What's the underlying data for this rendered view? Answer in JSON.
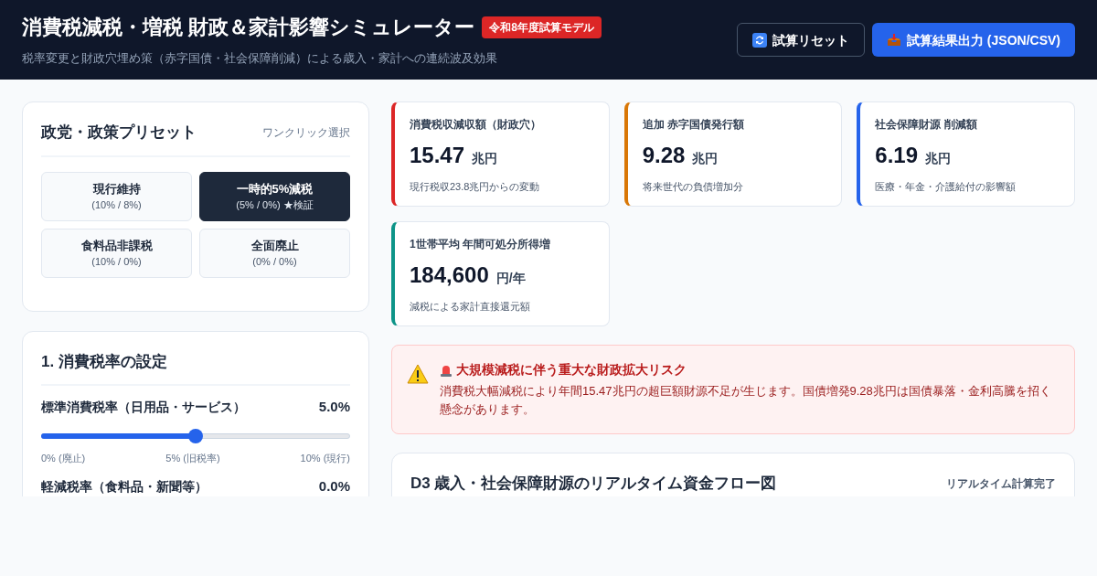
{
  "header": {
    "title": "消費税減税・増税 財政＆家計影響シミュレーター",
    "badge": "令和8年度試算モデル",
    "subtitle": "税率変更と財政穴埋め策（赤字国債・社会保障削減）による歳入・家計への連続波及効果",
    "buttons": [
      {
        "kind": "reset",
        "label": "試算リセット"
      },
      {
        "kind": "export",
        "label": "試算結果出力 (JSON/CSV)"
      }
    ]
  },
  "presets": {
    "title": "政党・政策プリセット",
    "hint": "ワンクリック選択",
    "items": [
      {
        "name": "現行維持",
        "rates": "(10% / 8%)",
        "selected": false
      },
      {
        "name": "一時的5%減税",
        "rates": "(5% / 0%) ★検証",
        "selected": true
      },
      {
        "name": "食料品非課税",
        "rates": "(10% / 0%)",
        "selected": false
      },
      {
        "name": "全面廃止",
        "rates": "(0% / 0%)",
        "selected": false
      }
    ]
  },
  "settings": {
    "title": "1. 消費税率の設定",
    "rows": [
      {
        "kind": "slider",
        "label": "標準消費税率（日用品・サービス）",
        "value": "5.0%",
        "level": 0.5,
        "ticks": [
          "0% (廃止)",
          "5% (旧税率)",
          "10% (現行)"
        ]
      },
      {
        "kind": "label",
        "label": "軽減税率（食料品・新聞等）",
        "value": "0.0%"
      }
    ]
  },
  "stats": [
    {
      "label": "消費税収減収額（財政穴）",
      "value": "15.47",
      "unit": "兆円",
      "note": "現行税収23.8兆円からの変動",
      "color": "#dc2626"
    },
    {
      "label": "追加 赤字国債発行額",
      "value": "9.28",
      "unit": "兆円",
      "note": "将来世代の負債増加分",
      "color": "#d97706"
    },
    {
      "label": "社会保障財源 削減額",
      "value": "6.19",
      "unit": "兆円",
      "note": "医療・年金・介護給付の影響額",
      "color": "#2563eb"
    },
    {
      "label": "1世帯平均 年間可処分所得増",
      "value": "184,600",
      "unit": "円/年",
      "note": "減税による家計直接還元額",
      "color": "#0d9488"
    }
  ],
  "alert": {
    "title": "大規模減税に伴う重大な財政拡大リスク",
    "body": "消費税大幅減税により年間15.47兆円の超巨額財源不足が生じます。国債増発9.28兆円は国債暴落・金利高騰を招く懸念があります。"
  },
  "flow": {
    "title": "D3 歳入・社会保障財源のリアルタイム資金フロー図",
    "status": "リアルタイム計算完了"
  }
}
